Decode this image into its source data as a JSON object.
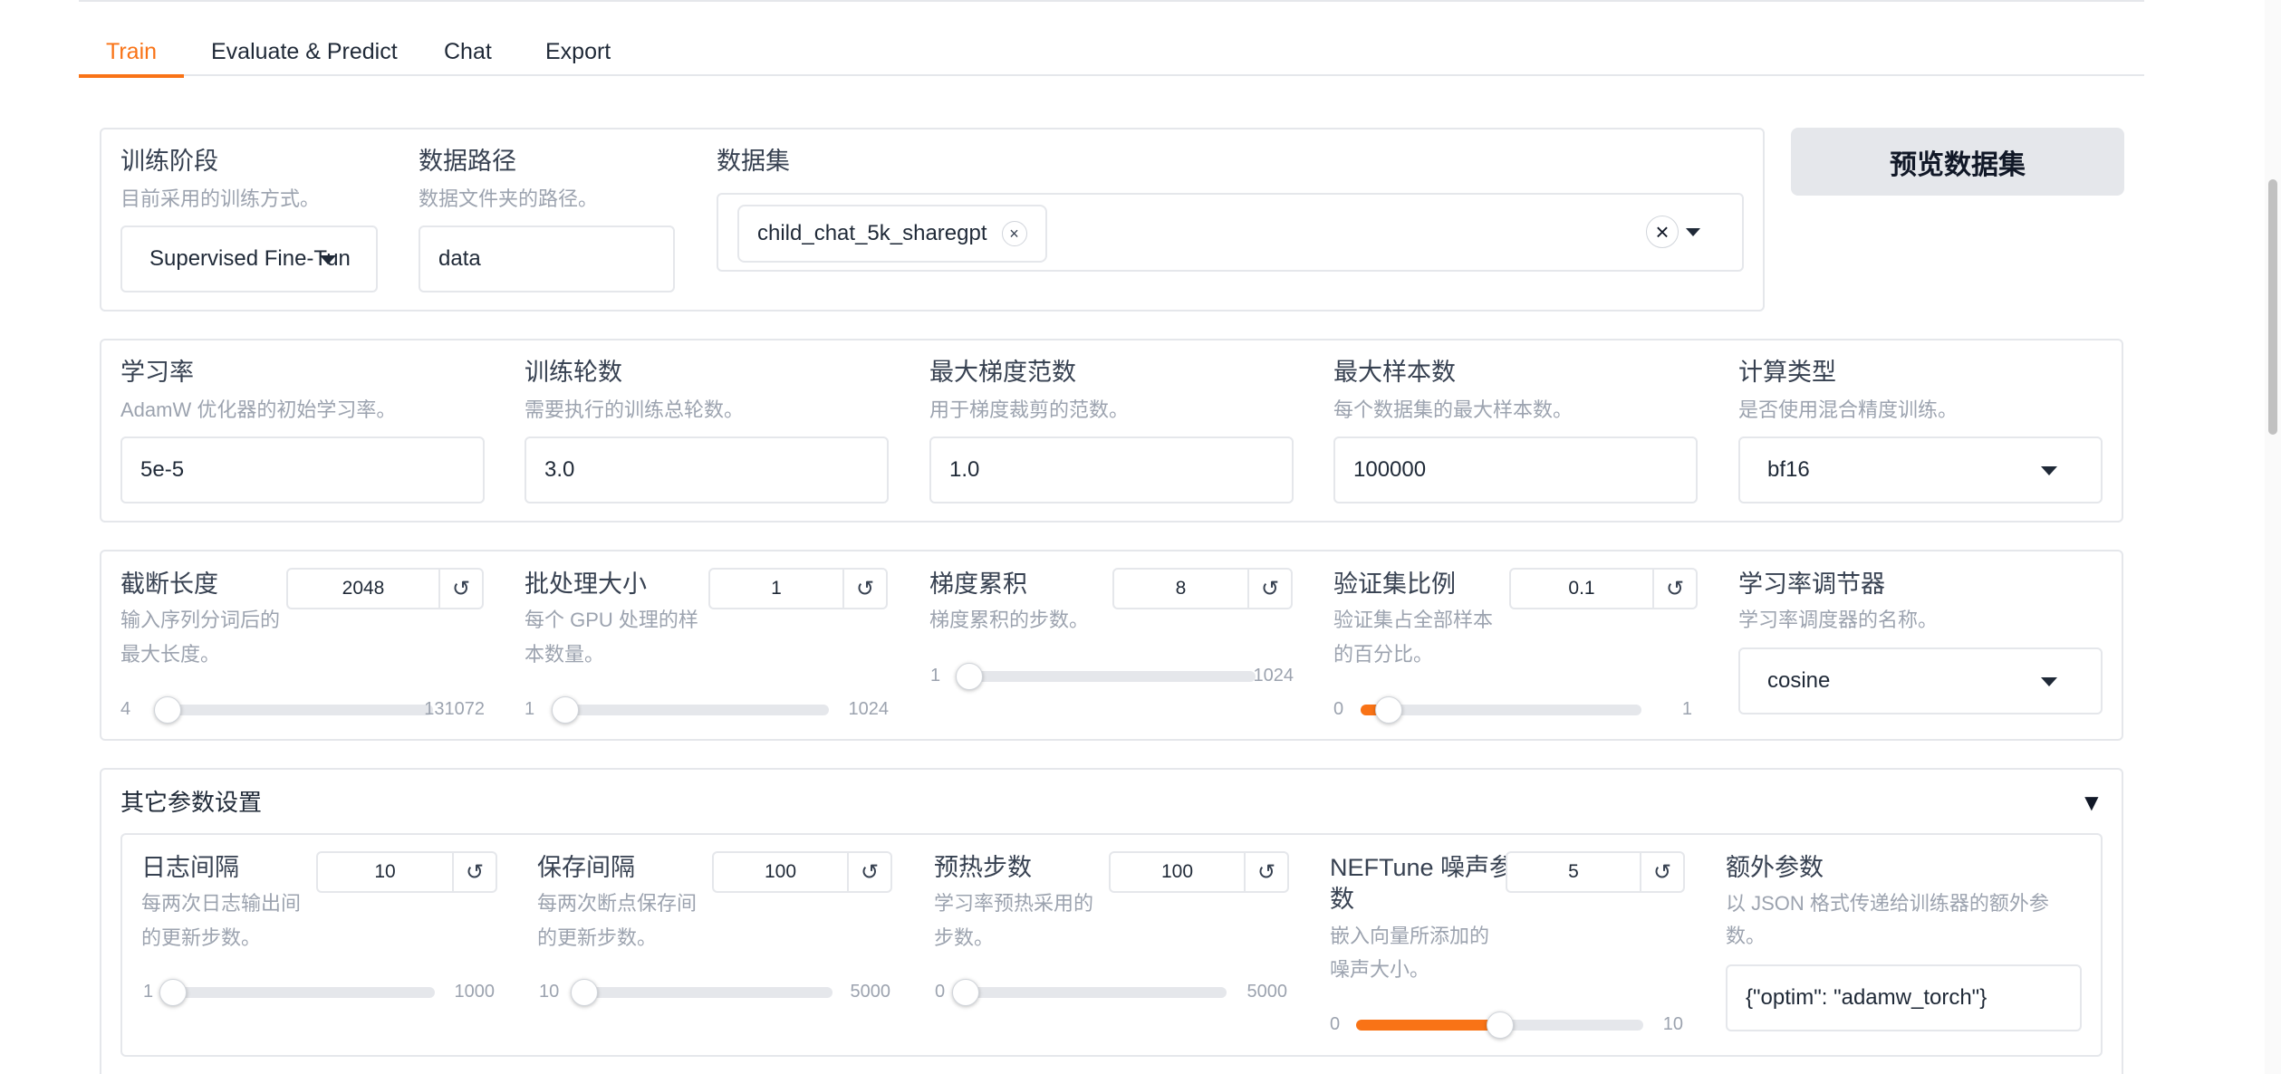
{
  "tabs": [
    "Train",
    "Evaluate & Predict",
    "Chat",
    "Export"
  ],
  "row1": {
    "stage": {
      "label": "训练阶段",
      "info": "目前采用的训练方式。",
      "value": "Supervised Fine-Tun"
    },
    "data_dir": {
      "label": "数据路径",
      "info": "数据文件夹的路径。",
      "value": "data"
    },
    "dataset": {
      "label": "数据集",
      "chip": "child_chat_5k_sharegpt",
      "chip_remove": "×",
      "clear": "×"
    },
    "preview_button": "预览数据集"
  },
  "row2": {
    "lr": {
      "label": "学习率",
      "info": "AdamW 优化器的初始学习率。",
      "value": "5e-5"
    },
    "epochs": {
      "label": "训练轮数",
      "info": "需要执行的训练总轮数。",
      "value": "3.0"
    },
    "grad_norm": {
      "label": "最大梯度范数",
      "info": "用于梯度裁剪的范数。",
      "value": "1.0"
    },
    "max_samples": {
      "label": "最大样本数",
      "info": "每个数据集的最大样本数。",
      "value": "100000"
    },
    "compute_type": {
      "label": "计算类型",
      "info": "是否使用混合精度训练。",
      "value": "bf16"
    }
  },
  "row3": {
    "cutoff": {
      "label": "截断长度",
      "info1": "输入序列分词后的",
      "info2": "最大长度。",
      "value": "2048",
      "min": "4",
      "max": "131072",
      "level": 0.0156
    },
    "batch": {
      "label": "批处理大小",
      "info1": "每个 GPU 处理的样",
      "info2": "本数量。",
      "value": "1",
      "min": "1",
      "max": "1024",
      "level": 0.0
    },
    "grad_acc": {
      "label": "梯度累积",
      "info1": "梯度累积的步数。",
      "value": "8",
      "min": "1",
      "max": "1024",
      "level": 0.0068
    },
    "val_size": {
      "label": "验证集比例",
      "info1": "验证集占全部样本",
      "info2": "的百分比。",
      "value": "0.1",
      "min": "0",
      "max": "1",
      "level": 0.1
    },
    "scheduler": {
      "label": "学习率调节器",
      "info": "学习率调度器的名称。",
      "value": "cosine"
    }
  },
  "extra": {
    "title": "其它参数设置",
    "toggle": "▼",
    "logging": {
      "label": "日志间隔",
      "info1": "每两次日志输出间",
      "info2": "的更新步数。",
      "value": "10",
      "min": "1",
      "max": "1000",
      "level": 0.009
    },
    "save": {
      "label": "保存间隔",
      "info1": "每两次断点保存间",
      "info2": "的更新步数。",
      "value": "100",
      "min": "10",
      "max": "5000",
      "level": 0.018
    },
    "warmup": {
      "label": "预热步数",
      "info1": "学习率预热采用的",
      "info2": "步数。",
      "value": "100",
      "min": "0",
      "max": "5000",
      "level": 0.02
    },
    "neftune": {
      "label1": "NEFTune 噪声参",
      "label2": "数",
      "info1": "嵌入向量所添加的",
      "info2": "噪声大小。",
      "value": "5",
      "min": "0",
      "max": "10",
      "level": 0.5
    },
    "extra_args": {
      "label": "额外参数",
      "info1": "以 JSON 格式传递给训练器的额外参",
      "info2": "数。",
      "value": "{\"optim\": \"adamw_torch\"}"
    }
  },
  "reset_glyph": "↺",
  "accent_color": "#f97316"
}
